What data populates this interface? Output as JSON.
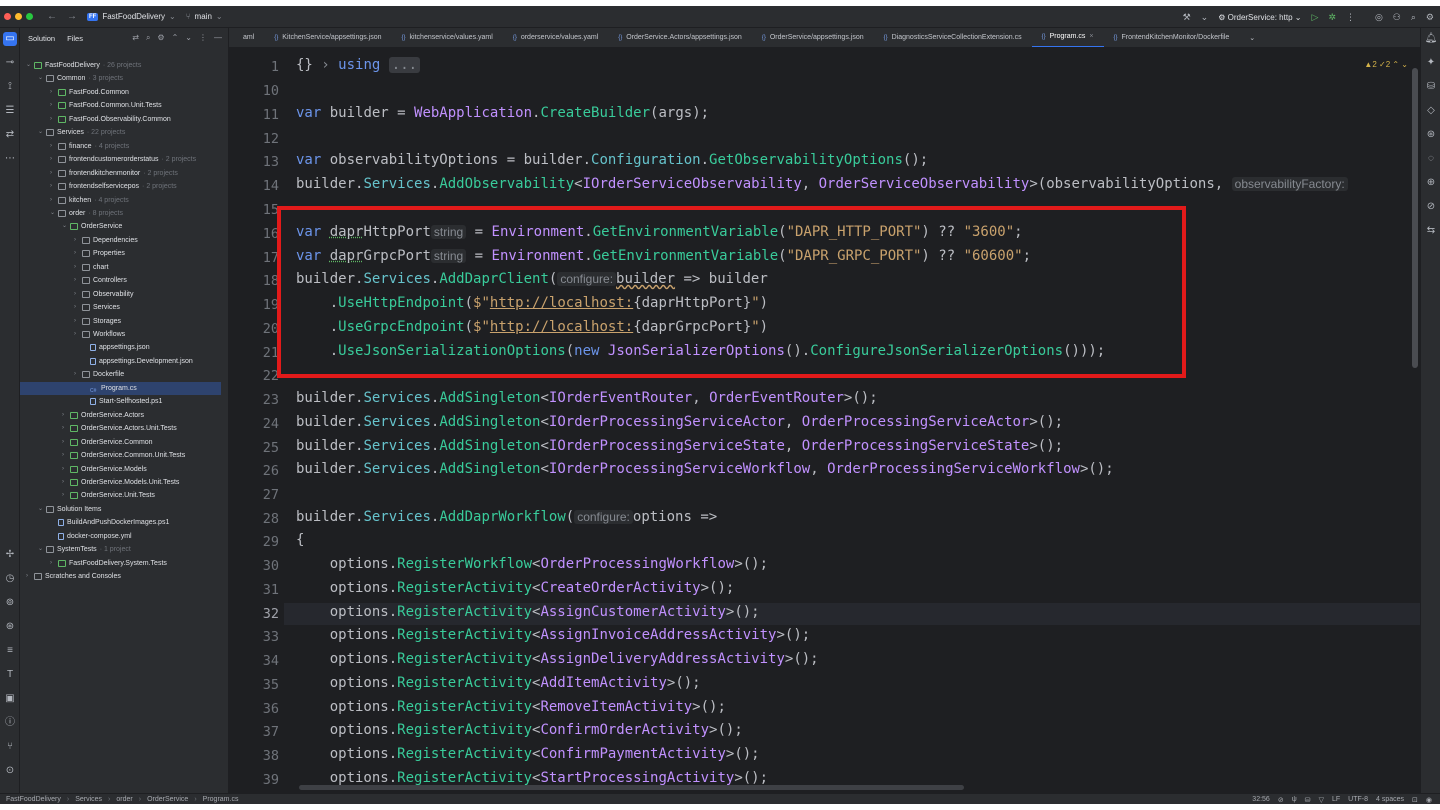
{
  "window": {
    "project_badge": "FF",
    "project_name": "FastFoodDelivery",
    "branch": "main",
    "run_config": "OrderService: http"
  },
  "project_panel": {
    "tab_solution": "Solution",
    "tab_files": "Files",
    "tree": [
      {
        "label": "FastFoodDelivery",
        "sub": "· 26 projects"
      },
      {
        "label": "Common",
        "sub": "· 3 projects"
      },
      {
        "label": "FastFood.Common",
        "sub": ""
      },
      {
        "label": "FastFood.Common.Unit.Tests",
        "sub": ""
      },
      {
        "label": "FastFood.Observability.Common",
        "sub": ""
      },
      {
        "label": "Services",
        "sub": "· 22 projects"
      },
      {
        "label": "finance",
        "sub": "· 4 projects"
      },
      {
        "label": "frontendcustomerorderstatus",
        "sub": "· 2 projects"
      },
      {
        "label": "frontendkitchenmonitor",
        "sub": "· 2 projects"
      },
      {
        "label": "frontendselfservicepos",
        "sub": "· 2 projects"
      },
      {
        "label": "kitchen",
        "sub": "· 4 projects"
      },
      {
        "label": "order",
        "sub": "· 8 projects"
      },
      {
        "label": "OrderService",
        "sub": ""
      },
      {
        "label": "Dependencies",
        "sub": ""
      },
      {
        "label": "Properties",
        "sub": ""
      },
      {
        "label": "chart",
        "sub": ""
      },
      {
        "label": "Controllers",
        "sub": ""
      },
      {
        "label": "Observability",
        "sub": ""
      },
      {
        "label": "Services",
        "sub": ""
      },
      {
        "label": "Storages",
        "sub": ""
      },
      {
        "label": "Workflows",
        "sub": ""
      },
      {
        "label": "appsettings.json",
        "sub": ""
      },
      {
        "label": "appsettings.Development.json",
        "sub": ""
      },
      {
        "label": "Dockerfile",
        "sub": ""
      },
      {
        "label": "Program.cs",
        "sub": ""
      },
      {
        "label": "Start-Selfhosted.ps1",
        "sub": ""
      },
      {
        "label": "OrderService.Actors",
        "sub": ""
      },
      {
        "label": "OrderService.Actors.Unit.Tests",
        "sub": ""
      },
      {
        "label": "OrderService.Common",
        "sub": ""
      },
      {
        "label": "OrderService.Common.Unit.Tests",
        "sub": ""
      },
      {
        "label": "OrderService.Models",
        "sub": ""
      },
      {
        "label": "OrderService.Models.Unit.Tests",
        "sub": ""
      },
      {
        "label": "OrderService.Unit.Tests",
        "sub": ""
      },
      {
        "label": "Solution Items",
        "sub": ""
      },
      {
        "label": "BuildAndPushDockerImages.ps1",
        "sub": ""
      },
      {
        "label": "docker-compose.yml",
        "sub": ""
      },
      {
        "label": "SystemTests",
        "sub": "· 1 project"
      },
      {
        "label": "FastFoodDelivery.System.Tests",
        "sub": ""
      },
      {
        "label": "Scratches and Consoles",
        "sub": ""
      }
    ]
  },
  "tabs": [
    {
      "label": "aml"
    },
    {
      "label": "KitchenService/appsettings.json"
    },
    {
      "label": "kitchenservice/values.yaml"
    },
    {
      "label": "orderservice/values.yaml"
    },
    {
      "label": "OrderService.Actors/appsettings.json"
    },
    {
      "label": "OrderService/appsettings.json"
    },
    {
      "label": "DiagnosticsServiceCollectionExtension.cs"
    },
    {
      "label": "Program.cs"
    },
    {
      "label": "FrontendKitchenMonitor/Dockerfile"
    }
  ],
  "editor": {
    "inspection": "▲2 ✓2 ⌃ ⌄",
    "line_numbers": [
      "1",
      "10",
      "11",
      "12",
      "13",
      "14",
      "15",
      "16",
      "17",
      "18",
      "19",
      "20",
      "21",
      "22",
      "23",
      "24",
      "25",
      "26",
      "27",
      "28",
      "29",
      "30",
      "31",
      "32",
      "33",
      "34",
      "35",
      "36",
      "37",
      "38",
      "39"
    ],
    "hints": {
      "string1": "string",
      "string2": "string",
      "configure1": "configure:",
      "configure2": "configure:",
      "factory": "observabilityFactory:"
    },
    "code": {
      "using": "using",
      "ellipsis": "...",
      "builder_create": "WebApplication",
      "http_port_env": "\"DAPR_HTTP_PORT\"",
      "http_port_default": "\"3600\"",
      "grpc_port_env": "\"DAPR_GRPC_PORT\"",
      "grpc_port_default": "\"60600\"",
      "http_url": "http://localhost:",
      "grpc_url": "http://localhost:"
    }
  },
  "statusbar": {
    "breadcrumbs": [
      "FastFoodDelivery",
      "Services",
      "order",
      "OrderService",
      "Program.cs"
    ],
    "position": "32:56",
    "line_ending": "LF",
    "encoding": "UTF-8",
    "indent": "4 spaces"
  },
  "colors": {
    "highlight_box": "#e21a1a",
    "accent": "#3574f0"
  }
}
